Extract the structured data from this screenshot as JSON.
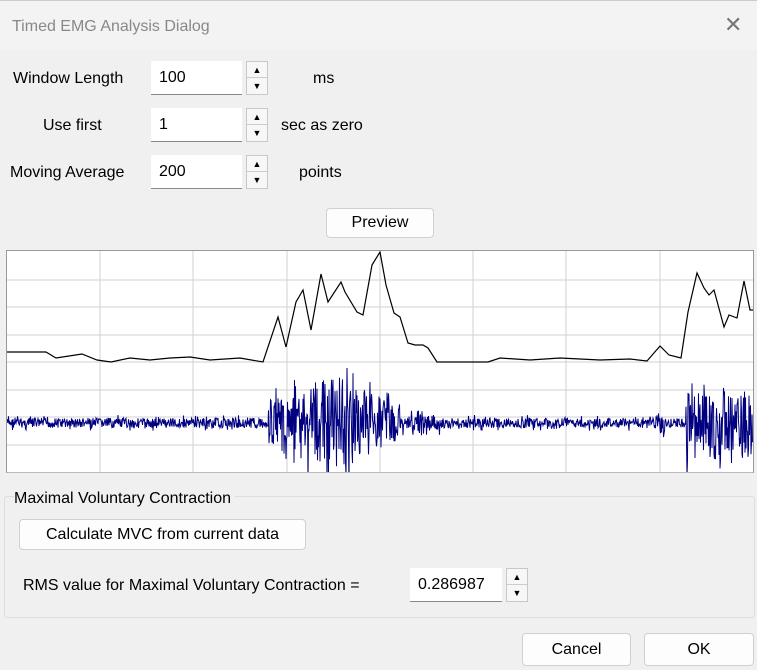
{
  "dialog": {
    "title": "Timed EMG Analysis Dialog",
    "close_icon": "close-icon"
  },
  "params": {
    "window_length": {
      "label": "Window Length",
      "value": "100",
      "unit": "ms"
    },
    "use_first": {
      "label": "Use first",
      "value": "1",
      "unit": "sec as zero"
    },
    "moving_average": {
      "label": "Moving Average",
      "value": "200",
      "unit": "points"
    }
  },
  "preview_label": "Preview",
  "plot": {
    "envelope_color": "#000000",
    "emg_color": "#000080",
    "grid_color": "#d0d0d0"
  },
  "mvc": {
    "group_title": "Maximal Voluntary Contraction",
    "calc_label": "Calculate MVC from current data",
    "rms_label": "RMS value for Maximal Voluntary Contraction =",
    "rms_value": "0.286987"
  },
  "footer": {
    "cancel": "Cancel",
    "ok": "OK"
  }
}
